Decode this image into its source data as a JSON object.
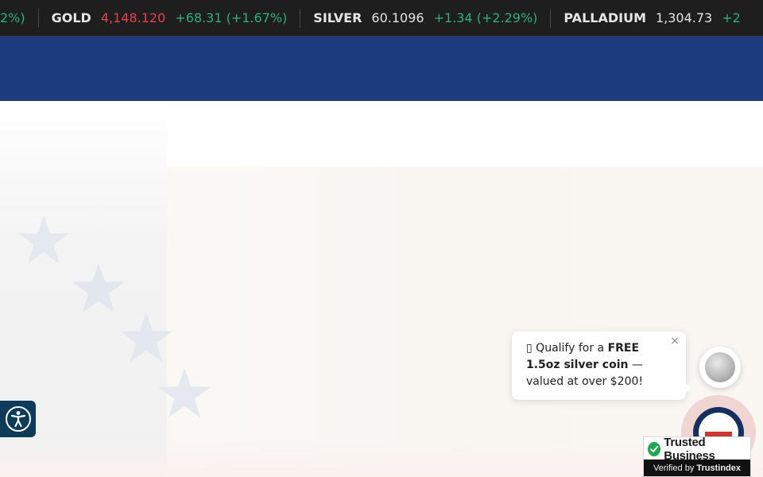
{
  "ticker": {
    "leading_fragment": "2%)",
    "items": [
      {
        "metal": "GOLD",
        "price": "4,148.120",
        "change": "+68.31 (+1.67%)"
      },
      {
        "metal": "SILVER",
        "price": "60.1096",
        "change": "+1.34 (+2.29%)"
      },
      {
        "metal": "PALLADIUM",
        "price": "1,304.73",
        "change": "+2"
      }
    ]
  },
  "promo": {
    "icon_glyph": "▯",
    "text_prefix": "Qualify for a ",
    "text_bold": "FREE 1.5oz silver coin",
    "text_suffix": " — valued at over $200!",
    "close": "×"
  },
  "trust_badge": {
    "title": "Trusted Business",
    "verified_prefix": "Verified by",
    "verified_brand": "Trustindex"
  },
  "colors": {
    "ticker_bg": "#1e1e1e",
    "header_blue": "#1c3a7e",
    "price_down": "#e8414b",
    "change_up": "#2fae7a",
    "accessibility_bg": "#0f3b5a",
    "trust_green": "#1fa84f"
  },
  "icons": {
    "accessibility": "accessibility-icon",
    "coin": "silver-coin-icon",
    "chat": "chat-avatar-icon",
    "trust_check": "check-circle-icon"
  }
}
